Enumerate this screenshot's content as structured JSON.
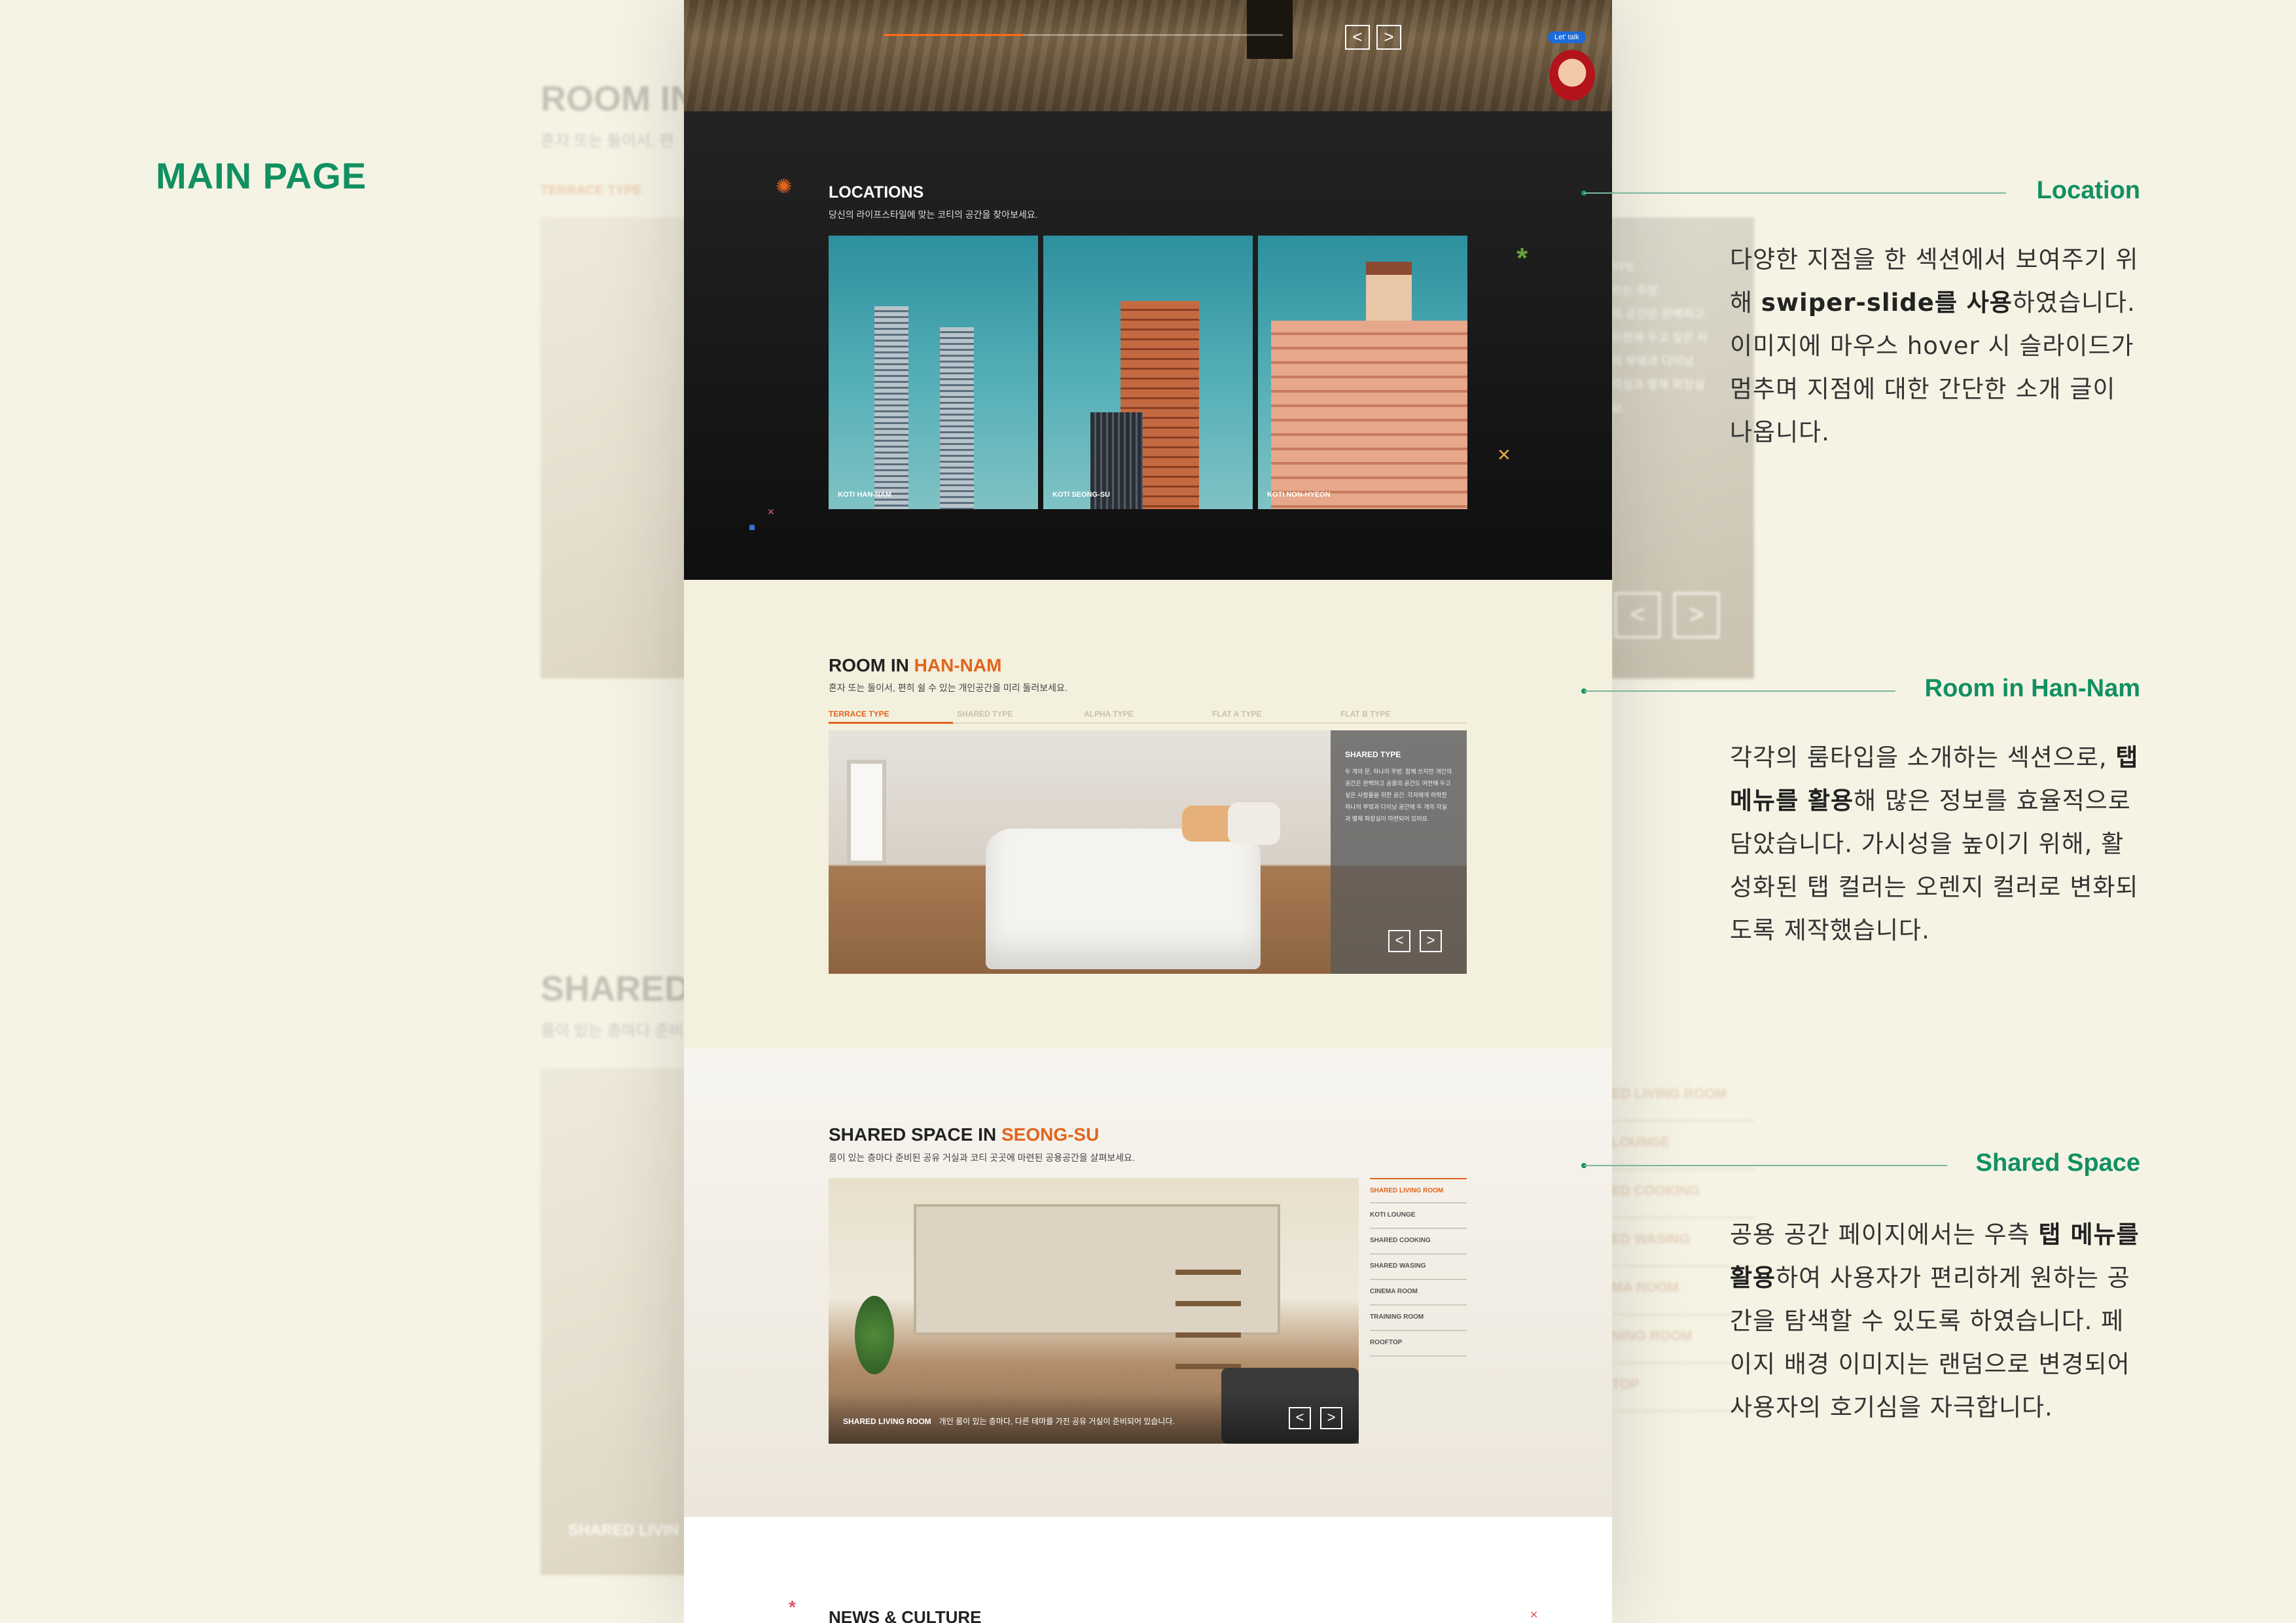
{
  "page_label": "MAIN PAGE",
  "hero": {
    "talk_badge": "Let' talk",
    "prev": "<",
    "next": ">"
  },
  "locations": {
    "title": "LOCATIONS",
    "subtitle": "당신의 라이프스타일에 맞는 코티의 공간을 찾아보세요.",
    "cards": [
      "KOTI HAN-NAM",
      "KOTI SEONG-SU",
      "KOTI NON-HYEON"
    ]
  },
  "room": {
    "title_prefix": "ROOM IN ",
    "title_accent": "HAN-NAM",
    "subtitle": "혼자 또는 둘이서, 편히 쉴 수 있는 개인공간을 미리 둘러보세요.",
    "tabs": [
      "TERRACE TYPE",
      "SHARED TYPE",
      "ALPHA TYPE",
      "FLAT A TYPE",
      "FLAT B TYPE"
    ],
    "active_tab": 0,
    "overlay_title": "SHARED TYPE",
    "overlay_text": "두 개의 문, 하나의 주방. 함께 쓰지만 개인의 공간은 완벽하고 공용의 공간도 여전해 두고 싶은 사람들을 위한 공간. 각자에게 허락한 하나의 부엌과 다이닝 공간에 두 개의 각실과 별채 화장실이 마련되어 있어요.",
    "prev": "<",
    "next": ">"
  },
  "shared": {
    "title_prefix": "SHARED SPACE IN ",
    "title_accent": "SEONG-SU",
    "subtitle": "룸이 있는 층마다 준비된 공유 거실과 코티 곳곳에 마련된 공용공간을 살펴보세요.",
    "caption_title": "SHARED LIVING ROOM",
    "caption_text": "개인 룸이 있는 층마다, 다른 테마를 가진 공유 거실이 준비되어 있습니다.",
    "menu": [
      "SHARED LIVING ROOM",
      "KOTI LOUNGE",
      "SHARED COOKING",
      "SHARED WASING",
      "CINEMA ROOM",
      "TRAINING ROOM",
      "ROOFTOP"
    ],
    "active_menu": 0,
    "prev": "<",
    "next": ">"
  },
  "news": {
    "title": "NEWS & CULTURE"
  },
  "backdrop": {
    "room_title": "ROOM IN",
    "room_sub": "혼자 또는 둘이서, 편",
    "terrace_tab": "TERRACE TYPE",
    "shared_title": "SHARED",
    "shared_sub": "룸이 있는 층마다 준비",
    "shared_caption": "SHARED LIVIN",
    "type_peek": [
      "YPE",
      "쓰는 주방.",
      "의 공간은 완벽하고",
      "쓰현해 두고 싶은 사",
      "의 부엌과 다이닝",
      "각실과 별채 화장실",
      "요."
    ],
    "menu_peek": [
      "ED LIVING ROOM",
      "LOUNGE",
      "ED COOKING",
      "ED WASING",
      "MA ROOM",
      "NING ROOM",
      "TOP"
    ]
  },
  "annotations": [
    {
      "title": "Location",
      "body_parts": [
        {
          "t": "다양한 지점을 한 섹션에서 보여주기 위해 ",
          "b": false
        },
        {
          "t": "swiper-slide를 사용",
          "b": true
        },
        {
          "t": "하였습니다. 이미지에 마우스 hover 시 슬라이드가 멈추며 지점에 대한 간단한 소개 글이 나옵니다.",
          "b": false
        }
      ]
    },
    {
      "title": "Room in Han-Nam",
      "body_parts": [
        {
          "t": "각각의 룸타입을 소개하는 섹션으로, ",
          "b": false
        },
        {
          "t": "탭 메뉴를 활용",
          "b": true
        },
        {
          "t": "해 많은 정보를 효율적으로 담았습니다. 가시성을 높이기 위해, 활성화된 탭 컬러는 오렌지 컬러로 변화되도록 제작했습니다.",
          "b": false
        }
      ]
    },
    {
      "title": "Shared Space",
      "body_parts": [
        {
          "t": "공용 공간 페이지에서는 우측 ",
          "b": false
        },
        {
          "t": "탭 메뉴를 활용",
          "b": true
        },
        {
          "t": "하여 사용자가 편리하게 원하는 공간을 탐색할 수 있도록 하였습니다. 페이지 배경 이미지는 랜덤으로 변경되어 사용자의 호기심을 자극합니다.",
          "b": false
        }
      ]
    }
  ],
  "colors": {
    "accent": "#e2641d",
    "annotation": "#119062",
    "background": "#f5f3e4"
  }
}
